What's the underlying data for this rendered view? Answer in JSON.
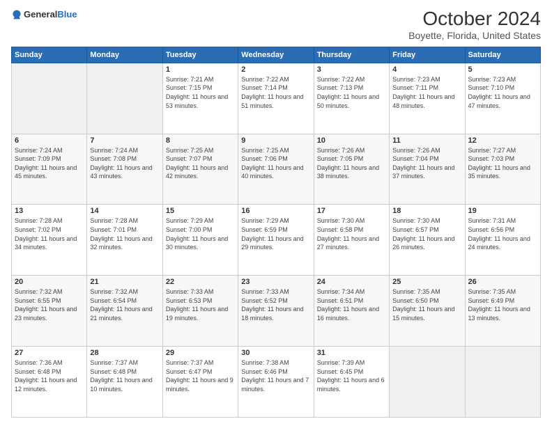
{
  "logo": {
    "text_general": "General",
    "text_blue": "Blue"
  },
  "title": "October 2024",
  "subtitle": "Boyette, Florida, United States",
  "headers": [
    "Sunday",
    "Monday",
    "Tuesday",
    "Wednesday",
    "Thursday",
    "Friday",
    "Saturday"
  ],
  "rows": [
    [
      {
        "day": "",
        "info": ""
      },
      {
        "day": "",
        "info": ""
      },
      {
        "day": "1",
        "info": "Sunrise: 7:21 AM\nSunset: 7:15 PM\nDaylight: 11 hours and 53 minutes."
      },
      {
        "day": "2",
        "info": "Sunrise: 7:22 AM\nSunset: 7:14 PM\nDaylight: 11 hours and 51 minutes."
      },
      {
        "day": "3",
        "info": "Sunrise: 7:22 AM\nSunset: 7:13 PM\nDaylight: 11 hours and 50 minutes."
      },
      {
        "day": "4",
        "info": "Sunrise: 7:23 AM\nSunset: 7:11 PM\nDaylight: 11 hours and 48 minutes."
      },
      {
        "day": "5",
        "info": "Sunrise: 7:23 AM\nSunset: 7:10 PM\nDaylight: 11 hours and 47 minutes."
      }
    ],
    [
      {
        "day": "6",
        "info": "Sunrise: 7:24 AM\nSunset: 7:09 PM\nDaylight: 11 hours and 45 minutes."
      },
      {
        "day": "7",
        "info": "Sunrise: 7:24 AM\nSunset: 7:08 PM\nDaylight: 11 hours and 43 minutes."
      },
      {
        "day": "8",
        "info": "Sunrise: 7:25 AM\nSunset: 7:07 PM\nDaylight: 11 hours and 42 minutes."
      },
      {
        "day": "9",
        "info": "Sunrise: 7:25 AM\nSunset: 7:06 PM\nDaylight: 11 hours and 40 minutes."
      },
      {
        "day": "10",
        "info": "Sunrise: 7:26 AM\nSunset: 7:05 PM\nDaylight: 11 hours and 38 minutes."
      },
      {
        "day": "11",
        "info": "Sunrise: 7:26 AM\nSunset: 7:04 PM\nDaylight: 11 hours and 37 minutes."
      },
      {
        "day": "12",
        "info": "Sunrise: 7:27 AM\nSunset: 7:03 PM\nDaylight: 11 hours and 35 minutes."
      }
    ],
    [
      {
        "day": "13",
        "info": "Sunrise: 7:28 AM\nSunset: 7:02 PM\nDaylight: 11 hours and 34 minutes."
      },
      {
        "day": "14",
        "info": "Sunrise: 7:28 AM\nSunset: 7:01 PM\nDaylight: 11 hours and 32 minutes."
      },
      {
        "day": "15",
        "info": "Sunrise: 7:29 AM\nSunset: 7:00 PM\nDaylight: 11 hours and 30 minutes."
      },
      {
        "day": "16",
        "info": "Sunrise: 7:29 AM\nSunset: 6:59 PM\nDaylight: 11 hours and 29 minutes."
      },
      {
        "day": "17",
        "info": "Sunrise: 7:30 AM\nSunset: 6:58 PM\nDaylight: 11 hours and 27 minutes."
      },
      {
        "day": "18",
        "info": "Sunrise: 7:30 AM\nSunset: 6:57 PM\nDaylight: 11 hours and 26 minutes."
      },
      {
        "day": "19",
        "info": "Sunrise: 7:31 AM\nSunset: 6:56 PM\nDaylight: 11 hours and 24 minutes."
      }
    ],
    [
      {
        "day": "20",
        "info": "Sunrise: 7:32 AM\nSunset: 6:55 PM\nDaylight: 11 hours and 23 minutes."
      },
      {
        "day": "21",
        "info": "Sunrise: 7:32 AM\nSunset: 6:54 PM\nDaylight: 11 hours and 21 minutes."
      },
      {
        "day": "22",
        "info": "Sunrise: 7:33 AM\nSunset: 6:53 PM\nDaylight: 11 hours and 19 minutes."
      },
      {
        "day": "23",
        "info": "Sunrise: 7:33 AM\nSunset: 6:52 PM\nDaylight: 11 hours and 18 minutes."
      },
      {
        "day": "24",
        "info": "Sunrise: 7:34 AM\nSunset: 6:51 PM\nDaylight: 11 hours and 16 minutes."
      },
      {
        "day": "25",
        "info": "Sunrise: 7:35 AM\nSunset: 6:50 PM\nDaylight: 11 hours and 15 minutes."
      },
      {
        "day": "26",
        "info": "Sunrise: 7:35 AM\nSunset: 6:49 PM\nDaylight: 11 hours and 13 minutes."
      }
    ],
    [
      {
        "day": "27",
        "info": "Sunrise: 7:36 AM\nSunset: 6:48 PM\nDaylight: 11 hours and 12 minutes."
      },
      {
        "day": "28",
        "info": "Sunrise: 7:37 AM\nSunset: 6:48 PM\nDaylight: 11 hours and 10 minutes."
      },
      {
        "day": "29",
        "info": "Sunrise: 7:37 AM\nSunset: 6:47 PM\nDaylight: 11 hours and 9 minutes."
      },
      {
        "day": "30",
        "info": "Sunrise: 7:38 AM\nSunset: 6:46 PM\nDaylight: 11 hours and 7 minutes."
      },
      {
        "day": "31",
        "info": "Sunrise: 7:39 AM\nSunset: 6:45 PM\nDaylight: 11 hours and 6 minutes."
      },
      {
        "day": "",
        "info": ""
      },
      {
        "day": "",
        "info": ""
      }
    ]
  ]
}
